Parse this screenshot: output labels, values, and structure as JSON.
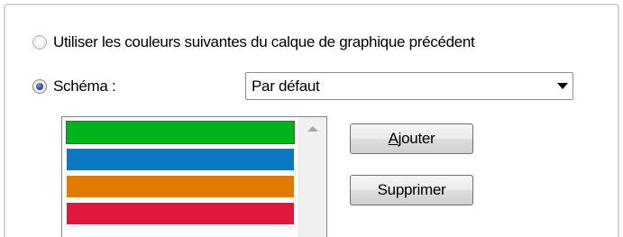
{
  "options": {
    "use_previous_label": "Utiliser les couleurs suivantes du calque de graphique précédent",
    "scheme_label": "Schéma :",
    "selected": "scheme"
  },
  "scheme_select": {
    "value": "Par défaut"
  },
  "color_list": {
    "swatches": [
      "#00b31d",
      "#0a78c2",
      "#e07a00",
      "#e01840"
    ]
  },
  "buttons": {
    "add_mnemonic": "A",
    "add_rest": "jouter",
    "remove_label": "Supprimer"
  }
}
